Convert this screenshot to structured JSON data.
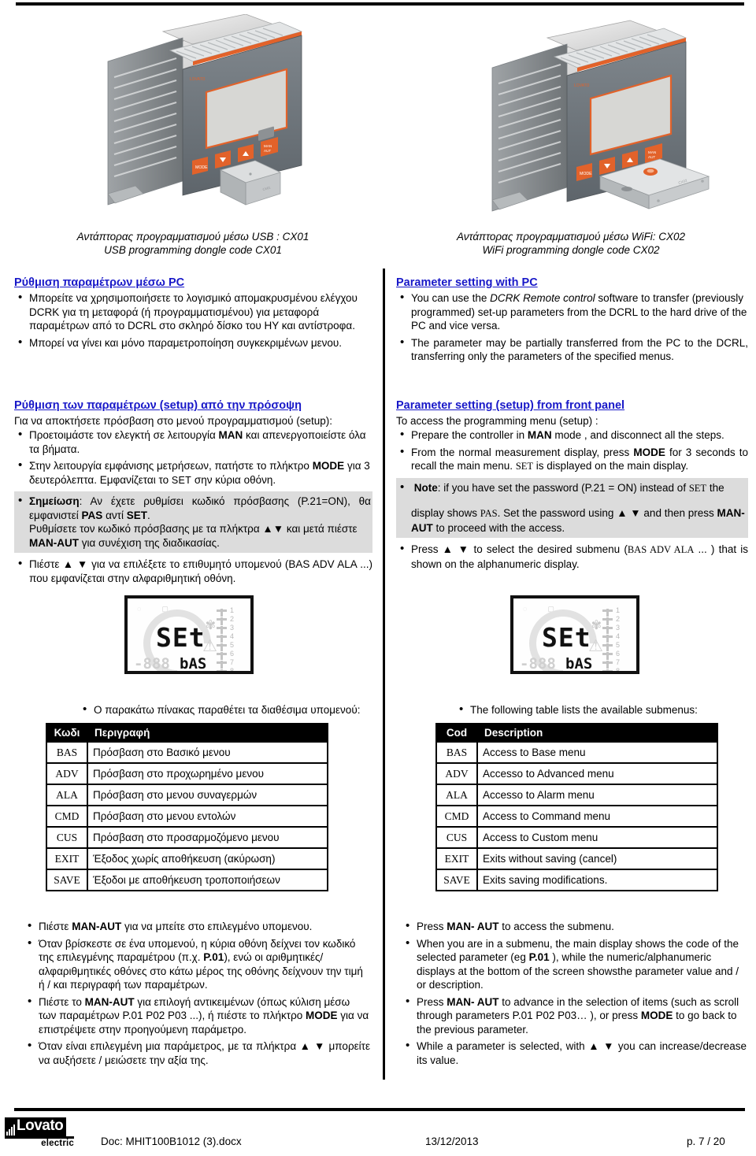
{
  "figures": {
    "left": {
      "caption_el": "Αντάπτορας προγραμματισμού μέσω USB : CX01",
      "caption_en": "USB programming dongle code CX01",
      "device_label": "DCRL controller with USB dongle"
    },
    "right": {
      "caption_el": "Αντάπτορας προγραμματισμού μέσω WiFi: CX02",
      "caption_en": "WiFi programming dongle code CX02",
      "device_label": "DCRL controller with WiFi dongle"
    }
  },
  "pc_section": {
    "el": {
      "heading": "Ρύθμιση παραμέτρων μέσω PC",
      "bullets": [
        "Μπορείτε να χρησιμοποιήσετε το λογισμικό απομακρυσμένου ελέγχου DCRK για τη μεταφορά (ή προγραμματισμένου) για μεταφορά παραμέτρων από το DCRL στο σκληρό δίσκο του ΗΥ και αντίστροφα.",
        "Μπορεί να γίνει και μόνο παραμετροποίηση συγκεκριμένων μενου."
      ]
    },
    "en": {
      "heading": "Parameter setting with  PC",
      "bullet1_pre": "You can use the ",
      "bullet1_italic": "DCRK Remote control",
      "bullet1_post": " software to transfer (previously programmed) set-up parameters from the DCRL to the hard drive of the PC and vice versa.",
      "bullet2": "The parameter may be partially transferred from the PC to the DCRL, transferring only the parameters of the specified menus."
    }
  },
  "front_panel_section": {
    "el": {
      "heading": "Ρύθμιση των παραμέτρων (setup) από την πρόσοψη",
      "lead": "Για να αποκτήσετε πρόσβαση στο μενού προγραμματισμού (setup):",
      "b1_a": "Προετοιμάστε τον ελεγκτή σε λειτουργία ",
      "b1_bold": "MAN",
      "b1_b": " και απενεργοποιείστε όλα τα βήματα.",
      "b2_a": "Στην λειτουργία εμφάνισης μετρήσεων, πατήστε το πλήκτρο ",
      "b2_bold": "MODE",
      "b2_b": " για 3 δευτερόλεπτα. Εμφανίζεται το ",
      "b2_sc": "SET",
      "b2_c": " σην κύρια οθόνη.",
      "note_label": "Σημείωση",
      "note_a": ": Αν έχετε ρυθμίσει κωδικό πρόσβασης (P.21=ON), θα εμφανιστεί ",
      "note_pas": "PAS",
      "note_b": " αντί ",
      "note_set": "SET",
      "note_c": ".",
      "note_line2_a": "Ρυθμίσετε τον κωδικό πρόσβασης με τα πλήκτρα ",
      "note_line2_arrows": "▲▼",
      "note_line2_b": " και μετά πιέστε ",
      "note_line2_bold": "MAN-AUT",
      "note_line2_c": " για συνέχιση της διαδικασίας.",
      "b4_a": "Πιέστε ",
      "b4_arrows": "▲  ▼",
      "b4_b": " για να επιλέξετε το επιθυμητό υπομενού (BAS ADV ALA ...) που εμφανίζεται στην αλφαριθμητική οθόνη."
    },
    "en": {
      "heading": "Parameter setting (setup) from front panel",
      "lead": "To access the programming menu (setup) :",
      "b1_a": "Prepare the controller in ",
      "b1_bold": "MAN",
      "b1_b": " mode , and disconnect all the steps.",
      "b2_a": "From the normal measurement display, press ",
      "b2_bold": "MODE",
      "b2_b": " for 3 seconds to recall the main menu. ",
      "b2_sc": "SET",
      "b2_c": " is displayed on the main display.",
      "note_label": "Note",
      "note_a": ": if you have set the password (P.21 = ON) instead of ",
      "note_set": "SET",
      "note_b": " the",
      "note_line2_a": "display shows ",
      "note_pas": "PAS",
      "note_line2_b": ". Set the password using ",
      "note_line2_arrows": "▲  ▼",
      "note_line2_c": " and then press ",
      "note_line2_bold": "MAN-AUT",
      "note_line2_d": " to proceed with the access.",
      "b4_a": "Press ",
      "b4_arrows": "▲  ▼",
      "b4_b": " to select the desired submenu (",
      "b4_sc": "BAS ADV ALA",
      "b4_c": " ... ) that is shown on the alphanumeric display."
    }
  },
  "lcd": {
    "main_value": "SEt",
    "sub_value": "bAS",
    "dim_value": "-888",
    "ladder_numbers": [
      "1",
      "2",
      "3",
      "4",
      "5",
      "6",
      "7",
      "8"
    ],
    "cos_label": "cos φ"
  },
  "table_intro": {
    "el": "Ο παρακάτω πίνακας παραθέτει τα διαθέσιμα υπομενού:",
    "en": "The following table lists the available submenus:"
  },
  "submenu_table": {
    "el": {
      "headers": [
        "Κωδι",
        "Περιγραφή"
      ],
      "rows": [
        [
          "BAS",
          "Πρόσβαση στο Βασικό μενου"
        ],
        [
          "ADV",
          "Πρόσβαση στο προχωρημένο μενου"
        ],
        [
          "ALA",
          "Πρόσβαση στο μενου συναγερμών"
        ],
        [
          "CMD",
          "Πρόσβαση στο μενου εντολών"
        ],
        [
          "CUS",
          "Πρόσβαση στο προσαρμοζόμενο μενου"
        ],
        [
          "EXIT",
          "Έξοδος χωρίς αποθήκευση (ακύρωση)"
        ],
        [
          "SAVE",
          "Έξοδοι με αποθήκευση τροποποιήσεων"
        ]
      ]
    },
    "en": {
      "headers": [
        "Cod",
        "Description"
      ],
      "rows": [
        [
          "BAS",
          "Access to Base menu"
        ],
        [
          "ADV",
          "Accesso to Advanced menu"
        ],
        [
          "ALA",
          "Accesso to Alarm menu"
        ],
        [
          "CMD",
          "Access to Command menu"
        ],
        [
          "CUS",
          "Access to Custom menu"
        ],
        [
          "EXIT",
          "Exits without saving (cancel)"
        ],
        [
          "SAVE",
          "Exits saving modifications."
        ]
      ]
    }
  },
  "bottom_section": {
    "el": {
      "b1_a": "Πιέστε ",
      "b1_bold": "MAN-AUT",
      "b1_b": " για να μπείτε στο επιλεγμένο υπομενου.",
      "b2_a": "Όταν βρίσκεστε σε ένα υπομενού, η κύρια οθόνη δείχνει τον κωδικό της επιλεγμένης παραμέτρου (π.χ. ",
      "b2_bold": "P.01",
      "b2_b": "), ενώ οι αριθμητικές/ αλφαριθμητικές οθόνες στο κάτω μέρος της οθόνης δείχνουν την τιμή ή / και περιγραφή των παραμέτρων.",
      "b3_a": "Πιέστε το ",
      "b3_bold": "MAN-AUT",
      "b3_b": " για επιλογή αντικειμένων (όπως κύλιση μέσω των παραμέτρων P.01 P02 P03 ...), ή πιέστε το πλήκτρο ",
      "b3_bold2": "MODE",
      "b3_c": " για να επιστρέψετε στην προηγούμενη παράμετρο.",
      "b4_a": "Όταν είναι επιλεγμένη μια παράμετρος, με τα πλήκτρα ",
      "b4_arrows": "▲  ▼",
      "b4_b": " μπορείτε να αυξήσετε / μειώσετε την αξία της."
    },
    "en": {
      "b1_a": "Press ",
      "b1_bold": "MAN- AUT",
      "b1_b": " to access the submenu.",
      "b2_a": "When you are in a submenu, the main display shows the code of the selected parameter (eg ",
      "b2_bold": "P.01",
      "b2_b": " ), while the numeric/alphanumeric displays at the bottom of the screen showsthe parameter value and / or description.",
      "b3_a": "Press ",
      "b3_bold": "MAN- AUT",
      "b3_b": " to advance in the selection of items (such as scroll through parameters P.01 P02 P03… ), or press ",
      "b3_bold2": "MODE",
      "b3_c": " to go back to the previous parameter.",
      "b4_a": "While a parameter is selected, with ",
      "b4_arrows": "▲  ▼",
      "b4_b": " you can increase/decrease its value."
    }
  },
  "footer": {
    "logo_name": "Lovato",
    "logo_sub": "electric",
    "doc": "Doc: MHIT100B1012 (3).docx",
    "date": "13/12/2013",
    "page": "p. 7 / 20"
  },
  "colors": {
    "heading_blue": "#1818c8",
    "note_grey": "#dcdcdc",
    "device_orange": "#e2622a",
    "rule_black": "#000000"
  }
}
